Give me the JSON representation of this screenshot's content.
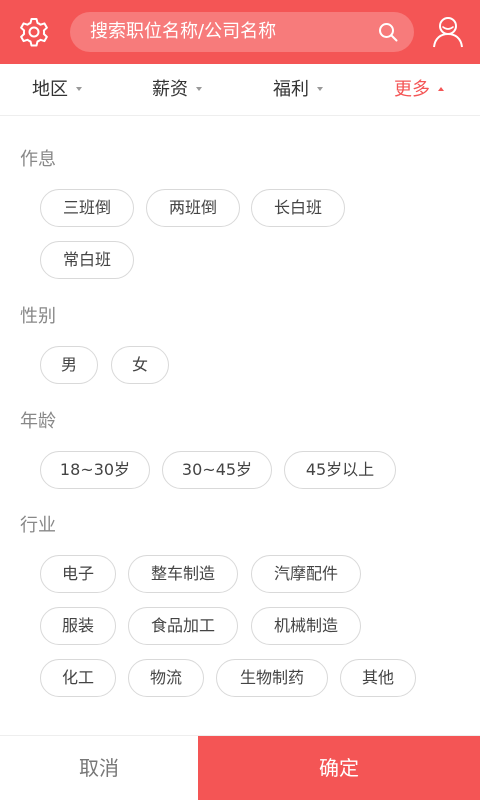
{
  "colors": {
    "accent": "#f45555",
    "search_bg": "#f77b7b",
    "chip_border": "#d9d9d9"
  },
  "header": {
    "settings_icon": "gear-icon",
    "search": {
      "placeholder": "搜索职位名称/公司名称",
      "icon": "search-icon"
    },
    "profile_icon": "user-icon"
  },
  "filters": {
    "region": "地区",
    "salary": "薪资",
    "benefits": "福利",
    "more": "更多",
    "active": "more"
  },
  "sections": {
    "schedule": {
      "title": "作息",
      "options": [
        "三班倒",
        "两班倒",
        "长白班",
        "常白班"
      ]
    },
    "gender": {
      "title": "性别",
      "options": [
        "男",
        "女"
      ]
    },
    "age": {
      "title": "年龄",
      "options": [
        "18~30岁",
        "30~45岁",
        "45岁以上"
      ]
    },
    "industry": {
      "title": "行业",
      "options": [
        "电子",
        "整车制造",
        "汽摩配件",
        "服装",
        "食品加工",
        "机械制造",
        "化工",
        "物流",
        "生物制药",
        "其他"
      ]
    }
  },
  "footer": {
    "cancel": "取消",
    "confirm": "确定"
  }
}
